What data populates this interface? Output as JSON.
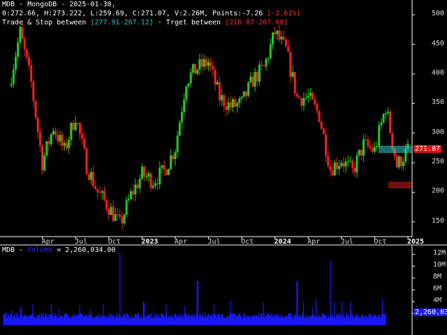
{
  "header": {
    "line1": "MDB - MongoDB - 2025-01-30,",
    "line2_prefix": "0:272.66, H:273.222, L:259.69, C:271.07, V:2.26M, Points:-7.26 ",
    "line2_change": "[-2.61%]",
    "line3_prefix": "Trade & Stop between ",
    "line3_trade": "[277.91-267.12]",
    "line3_mid": " - Trget between ",
    "line3_target": "[216.87-207.68]"
  },
  "price_axis": {
    "ticks": [
      "500",
      "450",
      "400",
      "350",
      "300",
      "250",
      "200",
      "150"
    ],
    "last_price": "271.07"
  },
  "time_axis": {
    "labels": [
      {
        "text": "Apr",
        "bold": false
      },
      {
        "text": "Jul",
        "bold": false
      },
      {
        "text": "Oct",
        "bold": false
      },
      {
        "text": "2023",
        "bold": true
      },
      {
        "text": "Apr",
        "bold": false
      },
      {
        "text": "Jul",
        "bold": false
      },
      {
        "text": "Oct",
        "bold": false
      },
      {
        "text": "2024",
        "bold": true
      },
      {
        "text": "Apr",
        "bold": false
      },
      {
        "text": "Jul",
        "bold": false
      },
      {
        "text": "Oct",
        "bold": false
      },
      {
        "text": "2025",
        "bold": true
      }
    ]
  },
  "volume_panel": {
    "label_prefix": "MDB - ",
    "label_name": "Volume",
    "label_value": " = 2,260,034.00",
    "ticks": [
      "12M",
      "10M",
      "8M",
      "6M",
      "4M",
      "2M"
    ],
    "last_volume": "2,260,03"
  },
  "colors": {
    "up": "#22cc22",
    "down": "#ee2222",
    "volume": "#1a1aff",
    "trade_zone": "#33c6c6",
    "target_zone": "#ff2020",
    "grid": "#333333"
  },
  "chart_data": [
    {
      "type": "candlestick",
      "title": "MDB - MongoDB - 2025-01-30",
      "ylim": [
        125,
        525
      ],
      "x_labels": [
        "Apr",
        "Jul",
        "Oct",
        "2023",
        "Apr",
        "Jul",
        "Oct",
        "2024",
        "Apr",
        "Jul",
        "Oct",
        "2025"
      ],
      "last": {
        "open": 272.66,
        "high": 273.222,
        "low": 259.69,
        "close": 271.07,
        "volume": 2260034
      },
      "trade_stop_zone": [
        267.12,
        277.91
      ],
      "target_zone": [
        207.68,
        216.87
      ],
      "approx_closes": [
        {
          "x": "2022-01",
          "y": 380
        },
        {
          "x": "2022-02",
          "y": 470
        },
        {
          "x": "2022-03",
          "y": 385
        },
        {
          "x": "2022-04",
          "y": 250
        },
        {
          "x": "2022-05",
          "y": 310
        },
        {
          "x": "2022-06",
          "y": 270
        },
        {
          "x": "2022-07",
          "y": 330
        },
        {
          "x": "2022-08",
          "y": 245
        },
        {
          "x": "2022-09",
          "y": 200
        },
        {
          "x": "2022-10",
          "y": 175
        },
        {
          "x": "2022-11",
          "y": 145
        },
        {
          "x": "2022-12",
          "y": 195
        },
        {
          "x": "2023-01",
          "y": 230
        },
        {
          "x": "2023-02",
          "y": 220
        },
        {
          "x": "2023-03",
          "y": 235
        },
        {
          "x": "2023-04",
          "y": 275
        },
        {
          "x": "2023-05",
          "y": 390
        },
        {
          "x": "2023-06",
          "y": 410
        },
        {
          "x": "2023-07",
          "y": 420
        },
        {
          "x": "2023-08",
          "y": 360
        },
        {
          "x": "2023-09",
          "y": 345
        },
        {
          "x": "2023-10",
          "y": 350
        },
        {
          "x": "2023-11",
          "y": 390
        },
        {
          "x": "2023-12",
          "y": 410
        },
        {
          "x": "2024-01",
          "y": 470
        },
        {
          "x": "2024-02",
          "y": 440
        },
        {
          "x": "2024-03",
          "y": 360
        },
        {
          "x": "2024-04",
          "y": 360
        },
        {
          "x": "2024-05",
          "y": 330
        },
        {
          "x": "2024-06",
          "y": 240
        },
        {
          "x": "2024-07",
          "y": 255
        },
        {
          "x": "2024-08",
          "y": 235
        },
        {
          "x": "2024-09",
          "y": 280
        },
        {
          "x": "2024-10",
          "y": 270
        },
        {
          "x": "2024-11",
          "y": 345
        },
        {
          "x": "2024-12",
          "y": 245
        },
        {
          "x": "2025-01",
          "y": 271
        }
      ]
    },
    {
      "type": "bar",
      "title": "MDB - Volume = 2,260,034.00",
      "ylim": [
        0,
        13000000
      ],
      "peaks": [
        {
          "x": "2022-11",
          "y": 12000000
        },
        {
          "x": "2024-06",
          "y": 11000000
        },
        {
          "x": "2024-12",
          "y": 10500000
        },
        {
          "x": "2023-06",
          "y": 7500000
        },
        {
          "x": "2024-03",
          "y": 7500000
        }
      ],
      "last_value": 2260034
    }
  ]
}
